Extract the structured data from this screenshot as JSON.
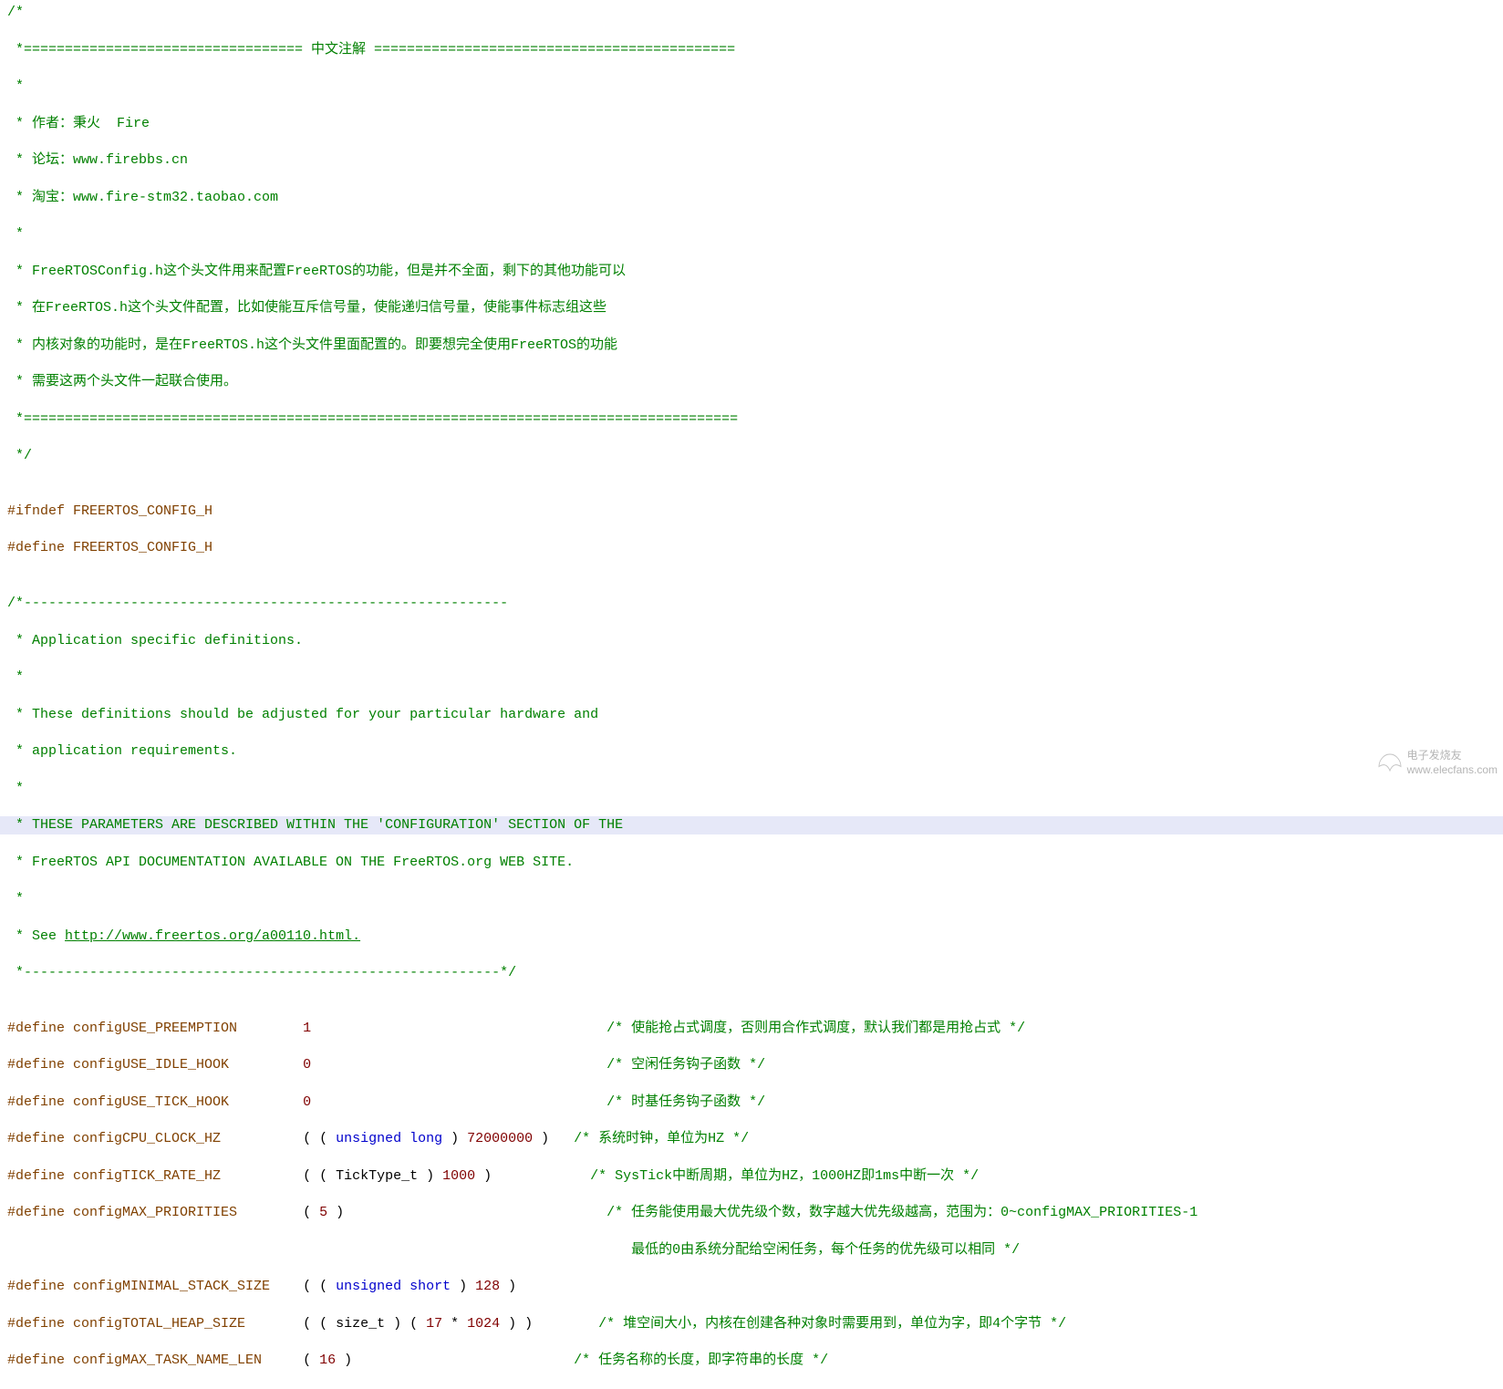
{
  "lines": [
    {
      "cls": "comment",
      "fold": "-",
      "text": "/*"
    },
    {
      "cls": "comment",
      "text": " *================================== 中文注解 ============================================"
    },
    {
      "cls": "comment",
      "text": " *"
    },
    {
      "cls": "comment",
      "text": " * 作者：秉火  Fire"
    },
    {
      "cls": "comment",
      "text": " * 论坛：www.firebbs.cn"
    },
    {
      "cls": "comment",
      "text": " * 淘宝：www.fire-stm32.taobao.com"
    },
    {
      "cls": "comment",
      "text": " *"
    },
    {
      "cls": "comment",
      "text": " * FreeRTOSConfig.h这个头文件用来配置FreeRTOS的功能，但是并不全面，剩下的其他功能可以"
    },
    {
      "cls": "comment",
      "text": " * 在FreeRTOS.h这个头文件配置，比如使能互斥信号量，使能递归信号量，使能事件标志组这些"
    },
    {
      "cls": "comment",
      "text": " * 内核对象的功能时，是在FreeRTOS.h这个头文件里面配置的。即要想完全使用FreeRTOS的功能"
    },
    {
      "cls": "comment",
      "text": " * 需要这两个头文件一起联合使用。"
    },
    {
      "cls": "comment",
      "text": " *======================================================================================="
    },
    {
      "cls": "comment",
      "fold": "-",
      "text": " */"
    },
    {
      "cls": "",
      "text": ""
    },
    {
      "cls": "preproc",
      "fold": "-",
      "text": "#ifndef FREERTOS_CONFIG_H"
    },
    {
      "cls": "preproc",
      "text": "#define FREERTOS_CONFIG_H"
    },
    {
      "cls": "",
      "text": ""
    },
    {
      "cls": "comment",
      "fold": "-",
      "text": "/*-----------------------------------------------------------"
    },
    {
      "cls": "comment",
      "text": " * Application specific definitions."
    },
    {
      "cls": "comment",
      "text": " *"
    },
    {
      "cls": "comment",
      "text": " * These definitions should be adjusted for your particular hardware and"
    },
    {
      "cls": "comment",
      "text": " * application requirements."
    },
    {
      "cls": "comment",
      "text": " *"
    },
    {
      "cls": "comment",
      "highlight": true,
      "text": " * THESE PARAMETERS ARE DESCRIBED WITHIN THE 'CONFIGURATION' SECTION OF THE"
    },
    {
      "cls": "comment",
      "text": " * FreeRTOS API DOCUMENTATION AVAILABLE ON THE FreeRTOS.org WEB SITE."
    },
    {
      "cls": "comment",
      "text": " *"
    },
    {
      "cls": "",
      "segments": [
        {
          "cls": "comment",
          "text": " * See "
        },
        {
          "cls": "url",
          "text": "http://www.freertos.org/a00110.html."
        }
      ]
    },
    {
      "cls": "comment",
      "text": " *----------------------------------------------------------*/"
    },
    {
      "cls": "",
      "text": ""
    },
    {
      "cls": "",
      "segments": [
        {
          "cls": "preproc",
          "text": "#define configUSE_PREEMPTION        "
        },
        {
          "cls": "num",
          "text": "1"
        },
        {
          "cls": "",
          "text": "                                    "
        },
        {
          "cls": "comment",
          "text": "/* 使能抢占式调度，否则用合作式调度，默认我们都是用抢占式 */"
        }
      ]
    },
    {
      "cls": "",
      "segments": [
        {
          "cls": "preproc",
          "text": "#define configUSE_IDLE_HOOK         "
        },
        {
          "cls": "num",
          "text": "0"
        },
        {
          "cls": "",
          "text": "                                    "
        },
        {
          "cls": "comment",
          "text": "/* 空闲任务钩子函数 */"
        }
      ]
    },
    {
      "cls": "",
      "segments": [
        {
          "cls": "preproc",
          "text": "#define configUSE_TICK_HOOK         "
        },
        {
          "cls": "num",
          "text": "0"
        },
        {
          "cls": "",
          "text": "                                    "
        },
        {
          "cls": "comment",
          "text": "/* 时基任务钩子函数 */"
        }
      ]
    },
    {
      "cls": "",
      "segments": [
        {
          "cls": "preproc",
          "text": "#define configCPU_CLOCK_HZ          "
        },
        {
          "cls": "",
          "text": "( ( "
        },
        {
          "cls": "kw",
          "text": "unsigned long"
        },
        {
          "cls": "",
          "text": " ) "
        },
        {
          "cls": "num",
          "text": "72000000"
        },
        {
          "cls": "",
          "text": " )   "
        },
        {
          "cls": "comment",
          "text": "/* 系统时钟，单位为HZ */"
        }
      ]
    },
    {
      "cls": "",
      "segments": [
        {
          "cls": "preproc",
          "text": "#define configTICK_RATE_HZ          "
        },
        {
          "cls": "",
          "text": "( ( TickType_t ) "
        },
        {
          "cls": "num",
          "text": "1000"
        },
        {
          "cls": "",
          "text": " )            "
        },
        {
          "cls": "comment",
          "text": "/* SysTick中断周期，单位为HZ，1000HZ即1ms中断一次 */"
        }
      ]
    },
    {
      "cls": "",
      "segments": [
        {
          "cls": "preproc",
          "text": "#define configMAX_PRIORITIES        "
        },
        {
          "cls": "",
          "text": "( "
        },
        {
          "cls": "num",
          "text": "5"
        },
        {
          "cls": "",
          "text": " )                                "
        },
        {
          "cls": "comment",
          "text": "/* 任务能使用最大优先级个数，数字越大优先级越高，范围为：0~configMAX_PRIORITIES-1"
        }
      ]
    },
    {
      "cls": "",
      "segments": [
        {
          "cls": "",
          "text": "                                                                            "
        },
        {
          "cls": "comment",
          "text": "最低的0由系统分配给空闲任务，每个任务的优先级可以相同 */"
        }
      ]
    },
    {
      "cls": "",
      "segments": [
        {
          "cls": "preproc",
          "text": "#define configMINIMAL_STACK_SIZE    "
        },
        {
          "cls": "",
          "text": "( ( "
        },
        {
          "cls": "kw",
          "text": "unsigned short"
        },
        {
          "cls": "",
          "text": " ) "
        },
        {
          "cls": "num",
          "text": "128"
        },
        {
          "cls": "",
          "text": " )"
        }
      ]
    },
    {
      "cls": "",
      "segments": [
        {
          "cls": "preproc",
          "text": "#define configTOTAL_HEAP_SIZE       "
        },
        {
          "cls": "",
          "text": "( ( size_t ) ( "
        },
        {
          "cls": "num",
          "text": "17"
        },
        {
          "cls": "",
          "text": " * "
        },
        {
          "cls": "num",
          "text": "1024"
        },
        {
          "cls": "",
          "text": " ) )        "
        },
        {
          "cls": "comment",
          "text": "/* 堆空间大小，内核在创建各种对象时需要用到，单位为字，即4个字节 */"
        }
      ]
    },
    {
      "cls": "",
      "segments": [
        {
          "cls": "preproc",
          "text": "#define configMAX_TASK_NAME_LEN     "
        },
        {
          "cls": "",
          "text": "( "
        },
        {
          "cls": "num",
          "text": "16"
        },
        {
          "cls": "",
          "text": " )                           "
        },
        {
          "cls": "comment",
          "text": "/* 任务名称的长度，即字符串的长度 */"
        }
      ]
    }
  ],
  "watermark": {
    "line1": "电子发烧友",
    "line2": "www.elecfans.com"
  }
}
